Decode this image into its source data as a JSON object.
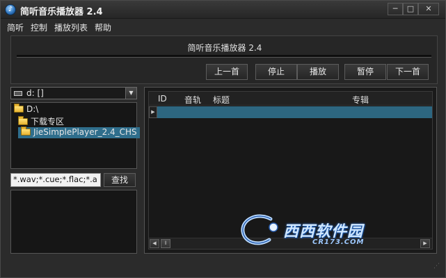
{
  "window": {
    "title": "简听音乐播放器 2.4",
    "controls": {
      "minimize": "─",
      "maximize": "□",
      "close": "✕"
    }
  },
  "menu": [
    "简听",
    "控制",
    "播放列表",
    "帮助"
  ],
  "player": {
    "now_playing_title": "简听音乐播放器 2.4",
    "progress": 0,
    "buttons": {
      "prev": "上一首",
      "stop": "停止",
      "play": "播放",
      "pause": "暂停",
      "next": "下一首"
    }
  },
  "browser": {
    "drive": "d: []",
    "tree": [
      {
        "label": "D:\\",
        "level": 0,
        "selected": false
      },
      {
        "label": "下载专区",
        "level": 1,
        "selected": false
      },
      {
        "label": "JieSimplePlayer_2.4_CHS",
        "level": 2,
        "selected": true
      }
    ],
    "filter_value": "*.wav;*.cue;*.flac;*.a",
    "find_label": "查找"
  },
  "playlist": {
    "columns": [
      "ID",
      "音轨",
      "标题",
      "专辑"
    ],
    "rows": [
      {
        "id": "",
        "track": "",
        "title": "",
        "album": ""
      }
    ]
  },
  "watermark": {
    "brand": "西西软件园",
    "site": "CR173.COM"
  },
  "icons": {
    "app": "app-logo-icon",
    "drive": "drive-icon",
    "folder": "folder-icon",
    "dropdown": "chevron-down-icon",
    "row_pointer": "triangle-right-icon"
  },
  "colors": {
    "accent": "#2d6680",
    "selection": "#2f6e8c",
    "background": "#2b2b2b"
  }
}
